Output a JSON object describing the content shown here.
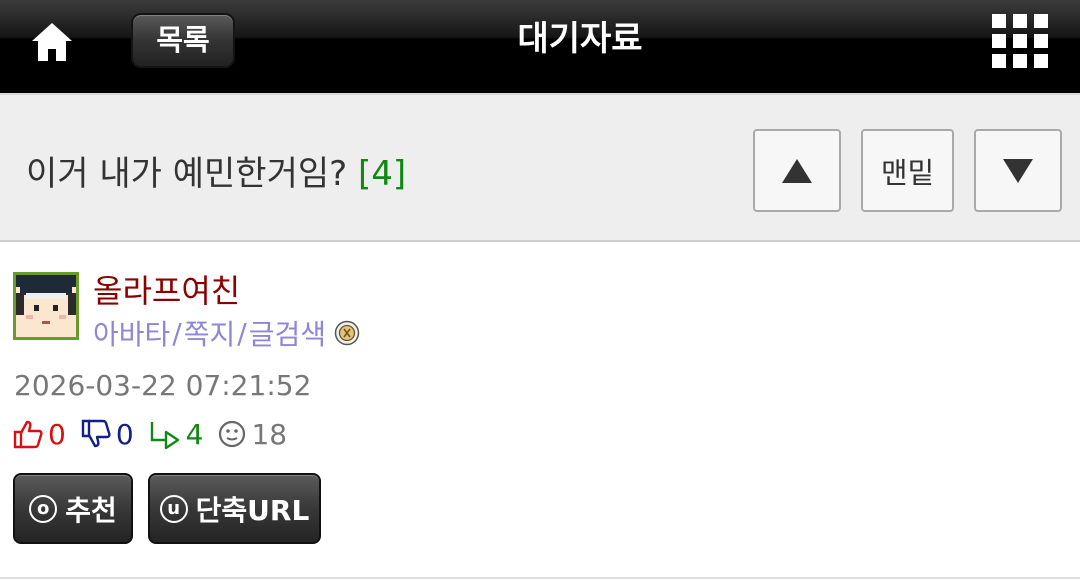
{
  "topbar": {
    "home_icon": "home-icon",
    "list_label": "목록",
    "title": "대기자료",
    "menu_icon": "grid-menu-icon"
  },
  "post": {
    "title": "이거 내가 예민한거임?",
    "comment_count": "[4]",
    "comment_count_color": "#118811"
  },
  "nav": {
    "up_label": "▲",
    "bottom_label": "맨밑",
    "down_label": "▼"
  },
  "author": {
    "name": "올라프여친",
    "name_color": "#8b0000",
    "links": [
      "아바타",
      "쪽지",
      "글검색"
    ],
    "separator": "/",
    "links_color": "#8e86d6",
    "badge_icon": "level-badge-icon"
  },
  "meta": {
    "date": "2026-03-22 07:21:52"
  },
  "stats": {
    "likes": "0",
    "dislikes": "0",
    "replies": "4",
    "views": "18",
    "like_color": "#d81010",
    "dislike_color": "#121e8a",
    "reply_color": "#118811"
  },
  "actions": {
    "recommend_icon_letter": "o",
    "recommend_label": "추천",
    "shorturl_icon_letter": "u",
    "shorturl_label": "단축URL"
  }
}
